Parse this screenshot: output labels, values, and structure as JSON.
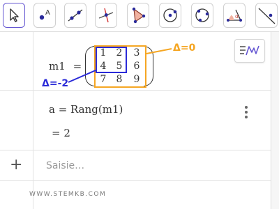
{
  "toolbar": {
    "tools": [
      {
        "icon": "move-arrow-icon",
        "active": true
      },
      {
        "icon": "point-icon",
        "active": false,
        "label": "A"
      },
      {
        "icon": "line-icon",
        "active": false
      },
      {
        "icon": "perpendicular-line-icon",
        "active": false
      },
      {
        "icon": "polygon-icon",
        "active": false
      },
      {
        "icon": "circle-center-point-icon",
        "active": false
      },
      {
        "icon": "circle-three-points-icon",
        "active": false
      },
      {
        "icon": "angle-icon",
        "active": false,
        "label": "α"
      },
      {
        "icon": "reflect-line-icon",
        "active": false
      }
    ]
  },
  "algebra": {
    "matrix": {
      "name": "m1",
      "equals": "=",
      "cells": [
        [
          "1",
          "2",
          "3"
        ],
        [
          "4",
          "5",
          "6"
        ],
        [
          "7",
          "8",
          "9"
        ]
      ]
    },
    "annotations": {
      "orange": "Δ=0",
      "blue": "Δ=-2",
      "orange_color": "#f5a623",
      "blue_color": "#2a2ad8"
    },
    "rank": {
      "definition": "a = Rang(m1)",
      "result": "= 2"
    },
    "input": {
      "plus": "+",
      "placeholder": "Saisie…"
    }
  },
  "watermark": "WWW.STEMKB.COM",
  "colors": {
    "accent": "#6557d2"
  }
}
